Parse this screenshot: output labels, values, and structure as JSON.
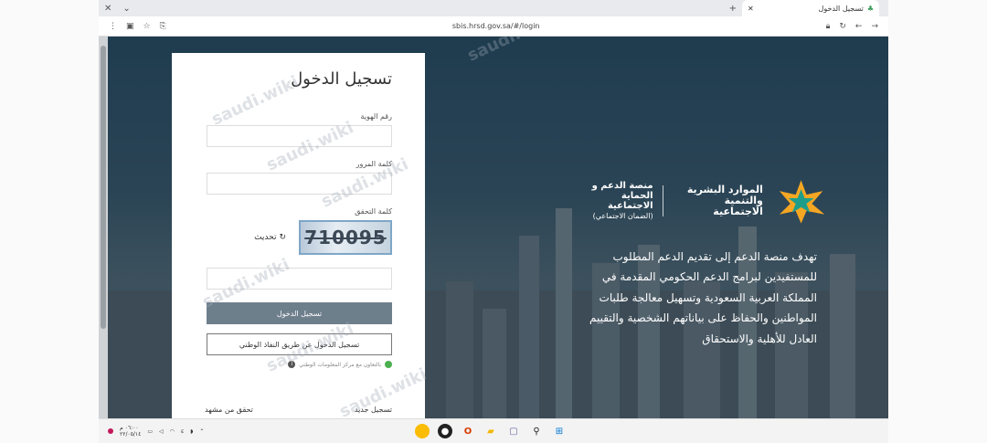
{
  "browser": {
    "tab_title": "تسجيل الدخول",
    "url": "sbis.hrsd.gov.sa/#/login"
  },
  "login": {
    "title": "تسجيل الدخول",
    "id_label": "رقم الهوية",
    "password_label": "كلمة المرور",
    "captcha_label": "كلمة التحقق",
    "captcha_text": "710095",
    "refresh_label": "تحديث",
    "submit_label": "تسجيل الدخول",
    "nafath_label": "تسجيل الدخول عن طريق النفاذ الوطني",
    "nic_note": "بالتعاون مع مركز المعلومات الوطني",
    "register_label": "تسجيل جديد",
    "verify_label": "تحقق من مشهد"
  },
  "branding": {
    "ministry_line1": "الموارد البشرية",
    "ministry_line2": "والتنمية الاجتماعية",
    "platform_line1": "منصة الدعم و",
    "platform_line2": "الحماية الاجتماعية",
    "platform_line3": "(الضمان الاجتماعي)"
  },
  "description": "تهدف منصة الدعم إلى تقديم الدعم المطلوب للمستفيدين لبرامج الدعم الحكومي المقدمة في المملكة العربية السعودية وتسهيل معالجة طلبات المواطنين والحفاظ على بياناتهم الشخصية والتقييم العادل للأهلية والاستحقاق",
  "watermark": "saudi.wiki",
  "taskbar": {
    "time": "٠٦:٠٠ م",
    "date": "٢٢/٠٥/١٤"
  }
}
